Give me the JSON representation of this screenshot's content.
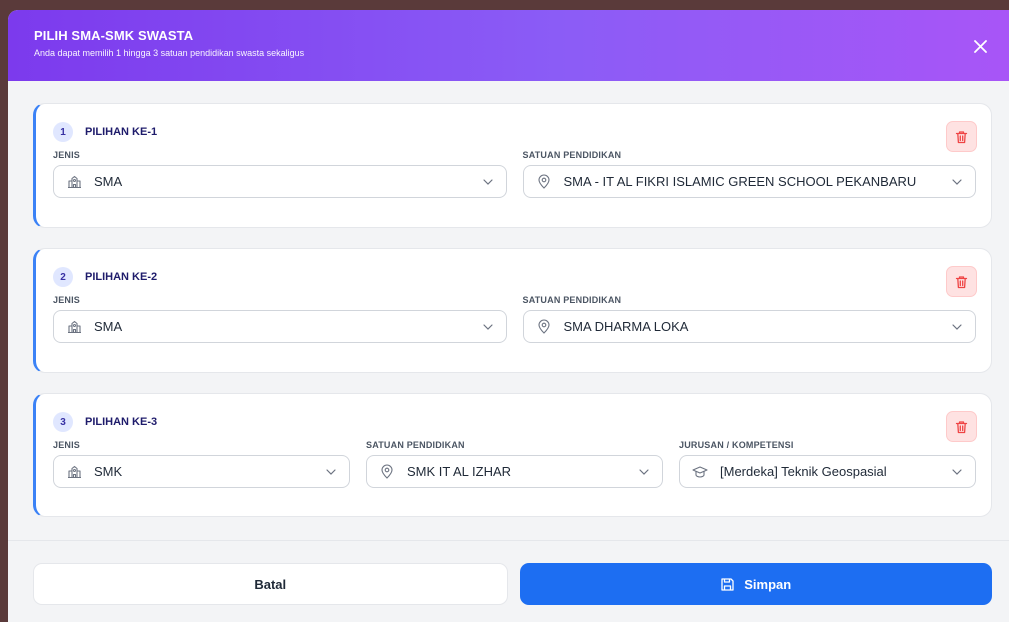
{
  "modal": {
    "title": "PILIH SMA-SMK SWASTA",
    "subtitle": "Anda dapat memilih 1 hingga 3 satuan pendidikan swasta sekaligus"
  },
  "choices": [
    {
      "number": "1",
      "title": "PILIHAN KE-1",
      "jenis_label": "JENIS",
      "jenis_value": "SMA",
      "satuan_label": "SATUAN PENDIDIKAN",
      "satuan_value": "SMA - IT AL FIKRI ISLAMIC GREEN SCHOOL PEKANBARU"
    },
    {
      "number": "2",
      "title": "PILIHAN KE-2",
      "jenis_label": "JENIS",
      "jenis_value": "SMA",
      "satuan_label": "SATUAN PENDIDIKAN",
      "satuan_value": "SMA DHARMA LOKA"
    },
    {
      "number": "3",
      "title": "PILIHAN KE-3",
      "jenis_label": "JENIS",
      "jenis_value": "SMK",
      "satuan_label": "SATUAN PENDIDIKAN",
      "satuan_value": "SMK IT AL IZHAR",
      "jurusan_label": "JURUSAN / KOMPETENSI",
      "jurusan_value": "[Merdeka] Teknik Geospasial"
    }
  ],
  "footer": {
    "cancel_label": "Batal",
    "save_label": "Simpan"
  },
  "colors": {
    "header_start": "#7c3aed",
    "header_end": "#a855f7",
    "accent": "#3b82f6",
    "save_button": "#1d6ef2",
    "delete": "#ef4444"
  },
  "icons": {
    "close": "close-icon",
    "delete": "trash-icon",
    "jenis": "school-building-icon",
    "satuan": "map-pin-icon",
    "jurusan": "graduation-cap-icon",
    "dropdown": "chevron-down-icon",
    "save": "save-icon"
  }
}
